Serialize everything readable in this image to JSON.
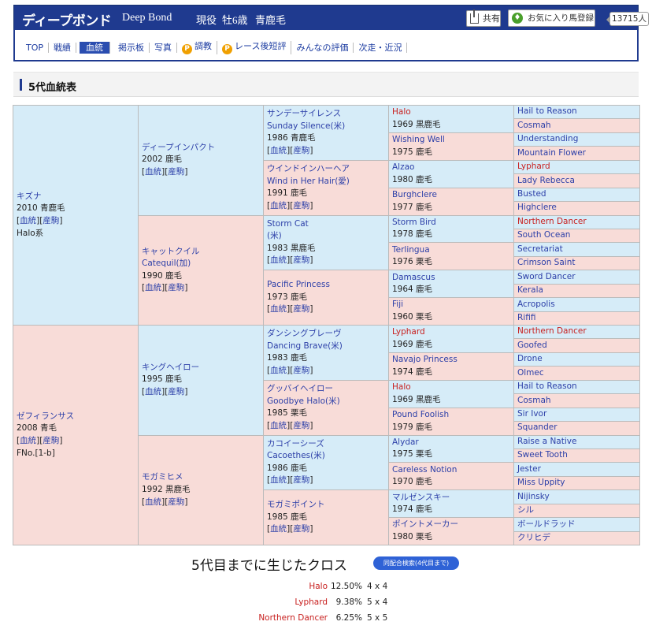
{
  "header": {
    "name": "ディープボンド",
    "name_en": "Deep Bond",
    "status": "現役",
    "sex_age": "牡6歳",
    "coat": "青鹿毛",
    "share_label": "共有",
    "fav_label": "お気に入り馬登録",
    "fav_count": "13715人"
  },
  "nav": [
    {
      "label": "TOP",
      "active": false,
      "icon": ""
    },
    {
      "label": "戦績",
      "active": false,
      "icon": ""
    },
    {
      "label": "血統",
      "active": true,
      "icon": ""
    },
    {
      "label": "掲示板",
      "active": false,
      "icon": ""
    },
    {
      "label": "写真",
      "active": false,
      "icon": ""
    },
    {
      "label": "調教",
      "active": false,
      "icon": "P"
    },
    {
      "label": "レース後短評",
      "active": false,
      "icon": "P"
    },
    {
      "label": "みんなの評価",
      "active": false,
      "icon": ""
    },
    {
      "label": "次走・近況",
      "active": false,
      "icon": ""
    }
  ],
  "section_title": "5代血統表",
  "link_labels": {
    "ketto": "血統",
    "sanku": "産駒"
  },
  "pedigree": {
    "g1": [
      {
        "name": "キズナ",
        "lines": [
          "2010 青鹿毛"
        ],
        "links": true,
        "extra": "Halo系",
        "sex": "m"
      },
      {
        "name": "ゼフィランサス",
        "lines": [
          "2008 青毛"
        ],
        "links": true,
        "extra": "FNo.[1-b]",
        "sex": "f"
      }
    ],
    "g2": [
      {
        "name": "ディープインパクト",
        "lines": [
          "2002 鹿毛"
        ],
        "links": true,
        "sex": "m"
      },
      {
        "name": "キャットクイル",
        "name2": "Catequil(加)",
        "lines": [
          "1990 鹿毛"
        ],
        "links": true,
        "sex": "f"
      },
      {
        "name": "キングヘイロー",
        "lines": [
          "1995 鹿毛"
        ],
        "links": true,
        "sex": "m"
      },
      {
        "name": "モガミヒメ",
        "lines": [
          "1992 黒鹿毛"
        ],
        "links": true,
        "sex": "f"
      }
    ],
    "g3": [
      {
        "name": "サンデーサイレンス",
        "name2": "Sunday Silence(米)",
        "lines": [
          "1986 青鹿毛"
        ],
        "links": true,
        "sex": "m"
      },
      {
        "name": "ウインドインハーヘア",
        "name2": "Wind in Her Hair(愛)",
        "lines": [
          "1991 鹿毛"
        ],
        "links": true,
        "sex": "f"
      },
      {
        "name": "Storm Cat",
        "name2": "(米)",
        "lines": [
          "1983 黒鹿毛"
        ],
        "links": true,
        "sex": "m"
      },
      {
        "name": "Pacific Princess",
        "lines": [
          "1973 鹿毛"
        ],
        "links": true,
        "sex": "f"
      },
      {
        "name": "ダンシングブレーヴ",
        "name2": "Dancing Brave(米)",
        "lines": [
          "1983 鹿毛"
        ],
        "links": true,
        "sex": "m"
      },
      {
        "name": "グッバイヘイロー",
        "name2": "Goodbye Halo(米)",
        "lines": [
          "1985 栗毛"
        ],
        "links": true,
        "sex": "f"
      },
      {
        "name": "カコイーシーズ",
        "name2": "Cacoethes(米)",
        "lines": [
          "1986 鹿毛"
        ],
        "links": true,
        "sex": "m"
      },
      {
        "name": "モガミポイント",
        "lines": [
          "1985 鹿毛"
        ],
        "links": true,
        "sex": "f"
      }
    ],
    "g4": [
      {
        "name": "Halo",
        "year": "1969 黒鹿毛",
        "sex": "m",
        "red": true
      },
      {
        "name": "Wishing Well",
        "year": "1975 鹿毛",
        "sex": "f",
        "red": false
      },
      {
        "name": "Alzao",
        "year": "1980 鹿毛",
        "sex": "m",
        "red": false
      },
      {
        "name": "Burghclere",
        "year": "1977 鹿毛",
        "sex": "f",
        "red": false
      },
      {
        "name": "Storm Bird",
        "year": "1978 鹿毛",
        "sex": "m",
        "red": false
      },
      {
        "name": "Terlingua",
        "year": "1976 栗毛",
        "sex": "f",
        "red": false
      },
      {
        "name": "Damascus",
        "year": "1964 鹿毛",
        "sex": "m",
        "red": false
      },
      {
        "name": "Fiji",
        "year": "1960 栗毛",
        "sex": "f",
        "red": false
      },
      {
        "name": "Lyphard",
        "year": "1969 鹿毛",
        "sex": "m",
        "red": true
      },
      {
        "name": "Navajo Princess",
        "year": "1974 鹿毛",
        "sex": "f",
        "red": false
      },
      {
        "name": "Halo",
        "year": "1969 黒鹿毛",
        "sex": "m",
        "red": true
      },
      {
        "name": "Pound Foolish",
        "year": "1979 鹿毛",
        "sex": "f",
        "red": false
      },
      {
        "name": "Alydar",
        "year": "1975 栗毛",
        "sex": "m",
        "red": false
      },
      {
        "name": "Careless Notion",
        "year": "1970 鹿毛",
        "sex": "f",
        "red": false
      },
      {
        "name": "マルゼンスキー",
        "year": "1974 鹿毛",
        "sex": "m",
        "red": false
      },
      {
        "name": "ポイントメーカー",
        "year": "1980 栗毛",
        "sex": "f",
        "red": false
      }
    ],
    "g5": [
      {
        "name": "Hail to Reason",
        "red": false
      },
      {
        "name": "Cosmah",
        "red": false
      },
      {
        "name": "Understanding",
        "red": false
      },
      {
        "name": "Mountain Flower",
        "red": false
      },
      {
        "name": "Lyphard",
        "red": true
      },
      {
        "name": "Lady Rebecca",
        "red": false
      },
      {
        "name": "Busted",
        "red": false
      },
      {
        "name": "Highclere",
        "red": false
      },
      {
        "name": "Northern Dancer",
        "red": true
      },
      {
        "name": "South Ocean",
        "red": false
      },
      {
        "name": "Secretariat",
        "red": false
      },
      {
        "name": "Crimson Saint",
        "red": false
      },
      {
        "name": "Sword Dancer",
        "red": false
      },
      {
        "name": "Kerala",
        "red": false
      },
      {
        "name": "Acropolis",
        "red": false
      },
      {
        "name": "Rififi",
        "red": false
      },
      {
        "name": "Northern Dancer",
        "red": true
      },
      {
        "name": "Goofed",
        "red": false
      },
      {
        "name": "Drone",
        "red": false
      },
      {
        "name": "Olmec",
        "red": false
      },
      {
        "name": "Hail to Reason",
        "red": false
      },
      {
        "name": "Cosmah",
        "red": false
      },
      {
        "name": "Sir Ivor",
        "red": false
      },
      {
        "name": "Squander",
        "red": false
      },
      {
        "name": "Raise a Native",
        "red": false
      },
      {
        "name": "Sweet Tooth",
        "red": false
      },
      {
        "name": "Jester",
        "red": false
      },
      {
        "name": "Miss Uppity",
        "red": false
      },
      {
        "name": "Nijinsky",
        "red": false
      },
      {
        "name": "シル",
        "red": false
      },
      {
        "name": "ボールドラッド",
        "red": false
      },
      {
        "name": "クリヒデ",
        "red": false
      }
    ]
  },
  "cross": {
    "title": "5代目までに生じたクロス",
    "button": "同配合検索(4代目まで)",
    "rows": [
      {
        "name": "Halo",
        "pct": "12.50%",
        "gen": "4 x 4"
      },
      {
        "name": "Lyphard",
        "pct": "9.38%",
        "gen": "5 x 4"
      },
      {
        "name": "Northern Dancer",
        "pct": "6.25%",
        "gen": "5 x 5"
      }
    ]
  }
}
